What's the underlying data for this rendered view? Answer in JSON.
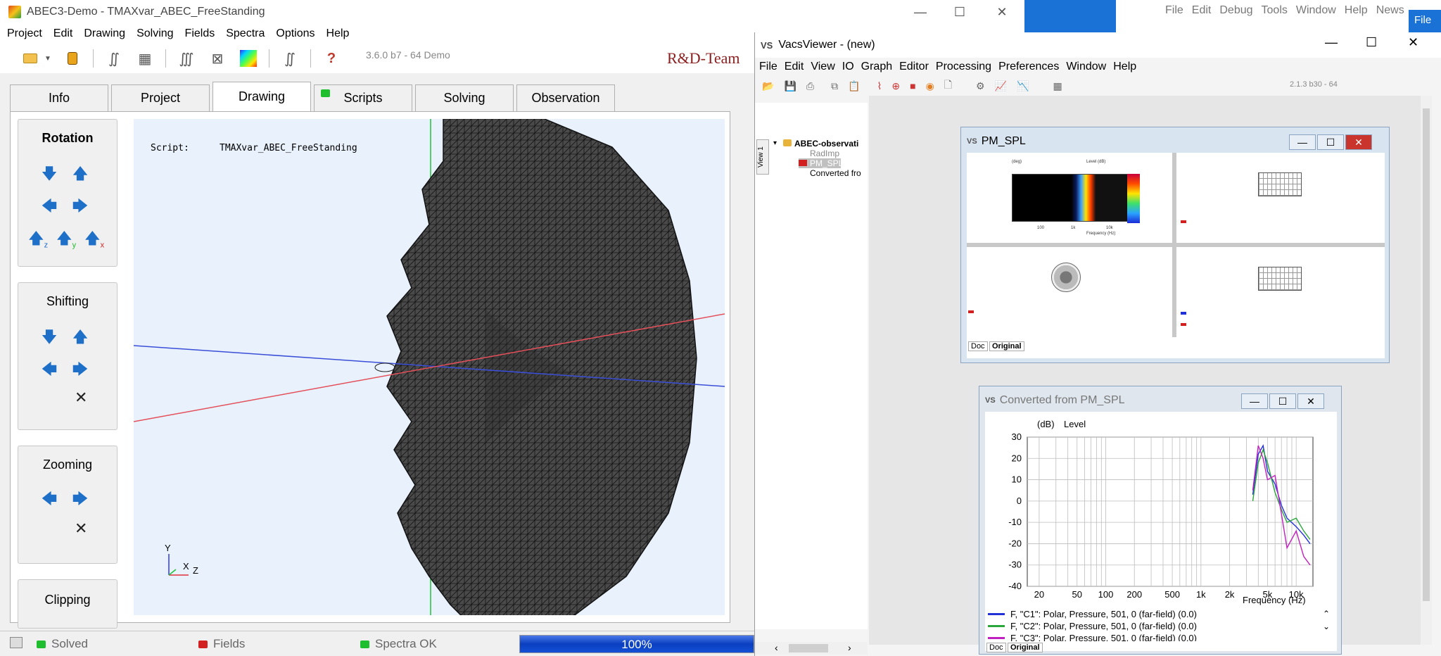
{
  "abec": {
    "title": "ABEC3-Demo - TMAXvar_ABEC_FreeStanding",
    "menu": [
      "Project",
      "Edit",
      "Drawing",
      "Solving",
      "Fields",
      "Spectra",
      "Options",
      "Help"
    ],
    "version": "3.6.0 b7 - 64 Demo",
    "brand": "R&D-Team",
    "tabs": [
      "Info",
      "Project",
      "Drawing",
      "Scripts",
      "Solving",
      "Observation"
    ],
    "active_tab": "Drawing",
    "groups": {
      "rotation": "Rotation",
      "shifting": "Shifting",
      "zooming": "Zooming",
      "clipping": "Clipping"
    },
    "axis_sub": [
      "z",
      "y",
      "x"
    ],
    "viewport": {
      "script_label": "Script:",
      "script_name": "TMAXvar_ABEC_FreeStanding",
      "axis_y": "Y",
      "axis_x": "X",
      "axis_z": "Z"
    },
    "status": {
      "solved": "Solved",
      "fields": "Fields",
      "spectra": "Spectra OK",
      "progress_text": "100%",
      "progress": 1.0
    },
    "colors": {
      "accent": "#1e6fc8",
      "green_led": "#1fbe2e",
      "red_led": "#d21f1f",
      "progress": "#0a3fbf"
    }
  },
  "background_app": {
    "menu": [
      "File",
      "Edit",
      "Debug",
      "Tools",
      "Window",
      "Help",
      "News"
    ],
    "file_button": "File"
  },
  "vacs": {
    "title": "VacsViewer - (new)",
    "menu": [
      "File",
      "Edit",
      "View",
      "IO",
      "Graph",
      "Editor",
      "Processing",
      "Preferences",
      "Window",
      "Help"
    ],
    "version": "2.1.3 b30 - 64",
    "view_tab": "View 1",
    "tree": {
      "root": "ABEC-observati",
      "items": [
        "RadImp",
        "PM_SPL",
        "Converted fro"
      ]
    },
    "pm_spl": {
      "title": "PM_SPL",
      "doc_tab": "Doc",
      "orig_tab": "Original",
      "thumb_labels": [
        "(deg)",
        "Level (dB)",
        "Frequency (Hz)",
        "10k",
        "1k",
        "100"
      ]
    },
    "converted": {
      "title": "Converted from PM_SPL",
      "doc_tab": "Doc",
      "orig_tab": "Original",
      "legend": [
        {
          "label": "F, \"C1\": Polar, Pressure, 501, 0 (far-field) (0.0)",
          "color": "#2230d8"
        },
        {
          "label": "F, \"C2\": Polar, Pressure, 501, 0 (far-field) (0.0)",
          "color": "#2aa63a"
        },
        {
          "label": "F, \"C3\": Polar, Pressure, 501, 0 (far-field) (0.0)",
          "color": "#c020c0"
        }
      ]
    }
  },
  "chart_data": {
    "type": "line",
    "title": "",
    "ylabel": "Level",
    "yunit": "(dB)",
    "xlabel": "Frequency (Hz)",
    "xscale": "log",
    "xlim": [
      15,
      15000
    ],
    "ylim": [
      -40,
      30
    ],
    "x_ticks": [
      20,
      50,
      100,
      200,
      500,
      1000,
      2000,
      5000,
      10000
    ],
    "x_tick_labels": [
      "20",
      "50",
      "100",
      "200",
      "500",
      "1k",
      "2k",
      "5k",
      "10k"
    ],
    "y_ticks": [
      30,
      20,
      10,
      0,
      -10,
      -20,
      -30,
      -40
    ],
    "grid": true,
    "series": [
      {
        "name": "F, \"C1\": Polar, Pressure, 501, 0 (far-field) (0.0)",
        "color": "#2230d8",
        "x": [
          3500,
          4000,
          4500,
          5000,
          6000,
          7000,
          8000,
          10000,
          12000,
          14000
        ],
        "values": [
          3,
          22,
          26,
          14,
          8,
          -2,
          -8,
          -12,
          -16,
          -20
        ]
      },
      {
        "name": "F, \"C2\": Polar, Pressure, 501, 0 (far-field) (0.0)",
        "color": "#2aa63a",
        "x": [
          3500,
          4000,
          4500,
          5000,
          6000,
          7000,
          8000,
          10000,
          12000,
          14000
        ],
        "values": [
          0,
          18,
          24,
          18,
          4,
          -4,
          -10,
          -8,
          -14,
          -18
        ]
      },
      {
        "name": "F, \"C3\": Polar, Pressure, 501, 0 (far-field) (0.0)",
        "color": "#c020c0",
        "x": [
          3500,
          4000,
          4500,
          5000,
          6000,
          7000,
          8000,
          10000,
          12000,
          14000
        ],
        "values": [
          5,
          26,
          20,
          10,
          12,
          -6,
          -22,
          -14,
          -26,
          -30
        ]
      }
    ]
  }
}
